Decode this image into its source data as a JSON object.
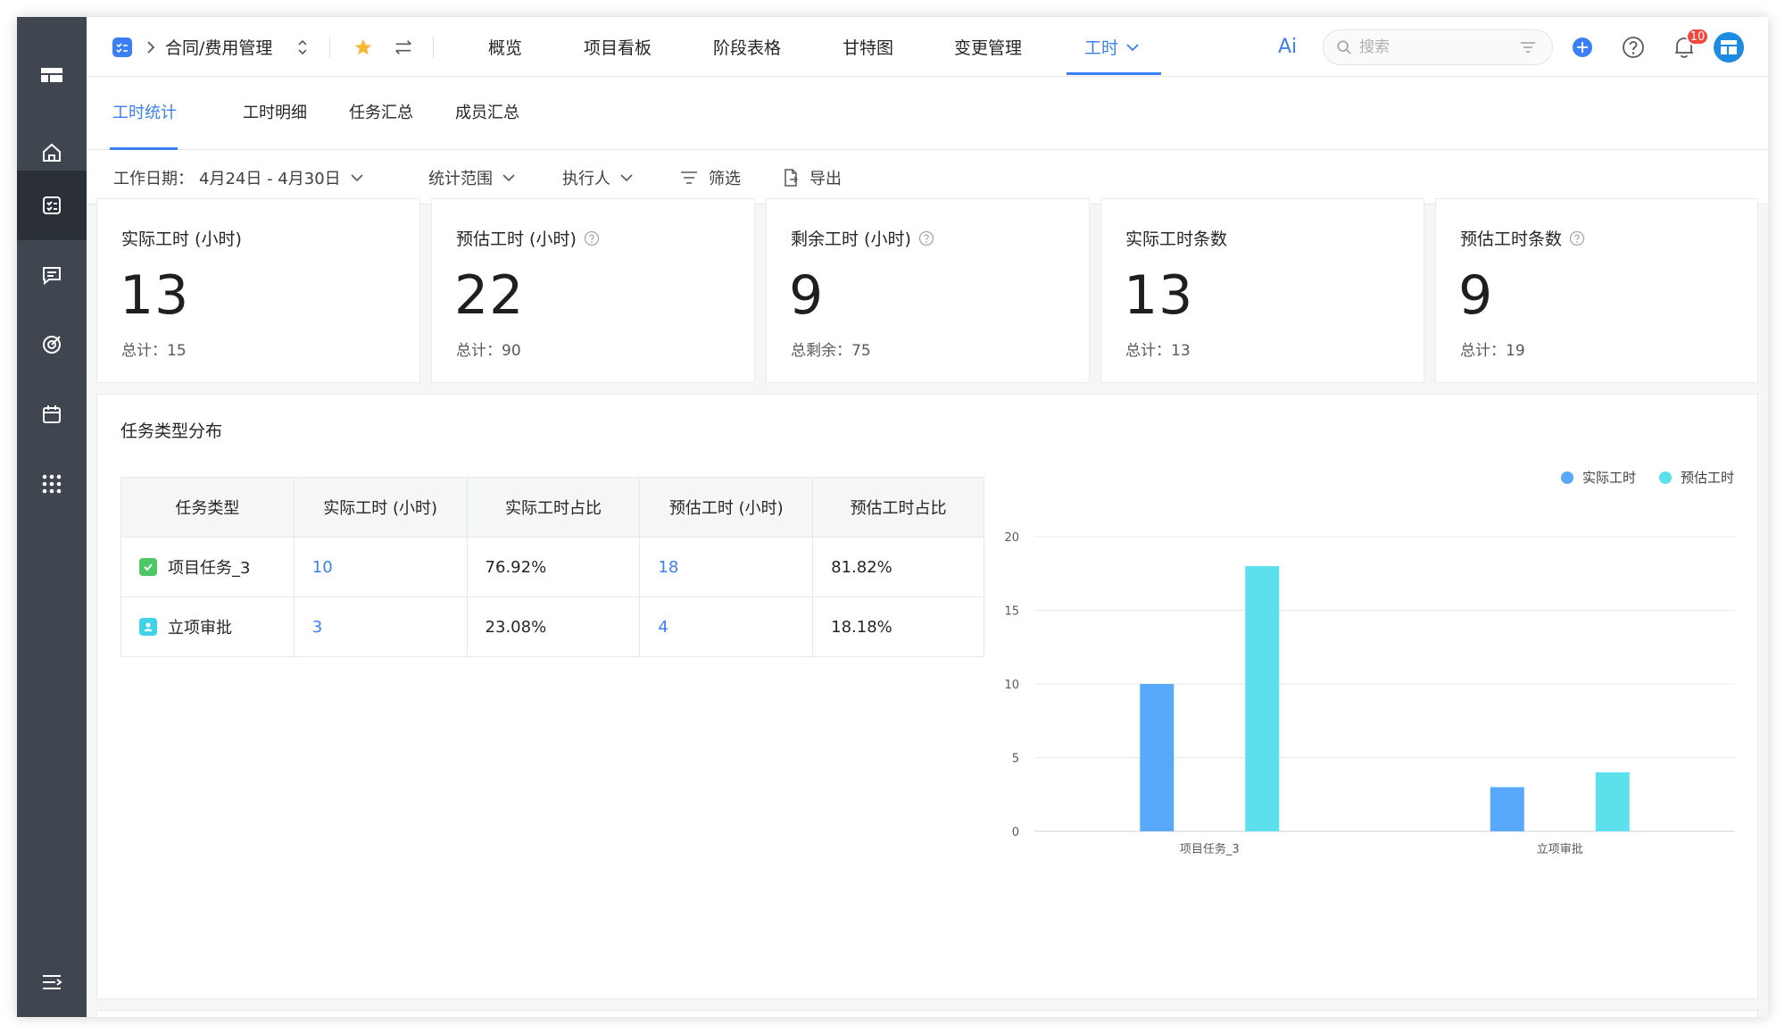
{
  "header": {
    "breadcrumb_title": "合同/费用管理",
    "nav_tabs": [
      "概览",
      "项目看板",
      "阶段表格",
      "甘特图",
      "变更管理",
      "工时"
    ],
    "active_tab": "工时",
    "ai_label": "Ai",
    "search_placeholder": "搜索",
    "notification_count": "10"
  },
  "subtabs": [
    "工时统计",
    "工时明细",
    "任务汇总",
    "成员汇总"
  ],
  "filters": {
    "date_label": "工作日期：",
    "date_value": "4月24日 - 4月30日",
    "scope": "统计范围",
    "assignee": "执行人",
    "filter": "筛选",
    "export": "导出"
  },
  "cards": [
    {
      "title": "实际工时 (小时)",
      "value": "13",
      "total": "总计：15",
      "help": false
    },
    {
      "title": "预估工时 (小时)",
      "value": "22",
      "total": "总计：90",
      "help": true
    },
    {
      "title": "剩余工时 (小时)",
      "value": "9",
      "total": "总剩余：75",
      "help": true
    },
    {
      "title": "实际工时条数",
      "value": "13",
      "total": "总计：13",
      "help": false
    },
    {
      "title": "预估工时条数",
      "value": "9",
      "total": "总计：19",
      "help": true
    }
  ],
  "panel": {
    "title": "任务类型分布",
    "table": {
      "headers": [
        "任务类型",
        "实际工时 (小时)",
        "实际工时占比",
        "预估工时 (小时)",
        "预估工时占比"
      ],
      "rows": [
        {
          "type": "项目任务_3",
          "actual": "10",
          "actual_pct": "76.92%",
          "est": "18",
          "est_pct": "81.82%",
          "icon_color": "#4cc765"
        },
        {
          "type": "立项审批",
          "actual": "3",
          "actual_pct": "23.08%",
          "est": "4",
          "est_pct": "18.18%",
          "icon_color": "#3fd3e8"
        }
      ]
    }
  },
  "chart_data": {
    "type": "bar",
    "categories": [
      "项目任务_3",
      "立项审批"
    ],
    "series": [
      {
        "name": "实际工时",
        "values": [
          10,
          3
        ],
        "color": "#58a8fb"
      },
      {
        "name": "预估工时",
        "values": [
          18,
          4
        ],
        "color": "#5ce1ec"
      }
    ],
    "ylim": [
      0,
      20
    ],
    "yticks": [
      0,
      5,
      10,
      15,
      20
    ],
    "grid": true,
    "legend": "top-right"
  }
}
